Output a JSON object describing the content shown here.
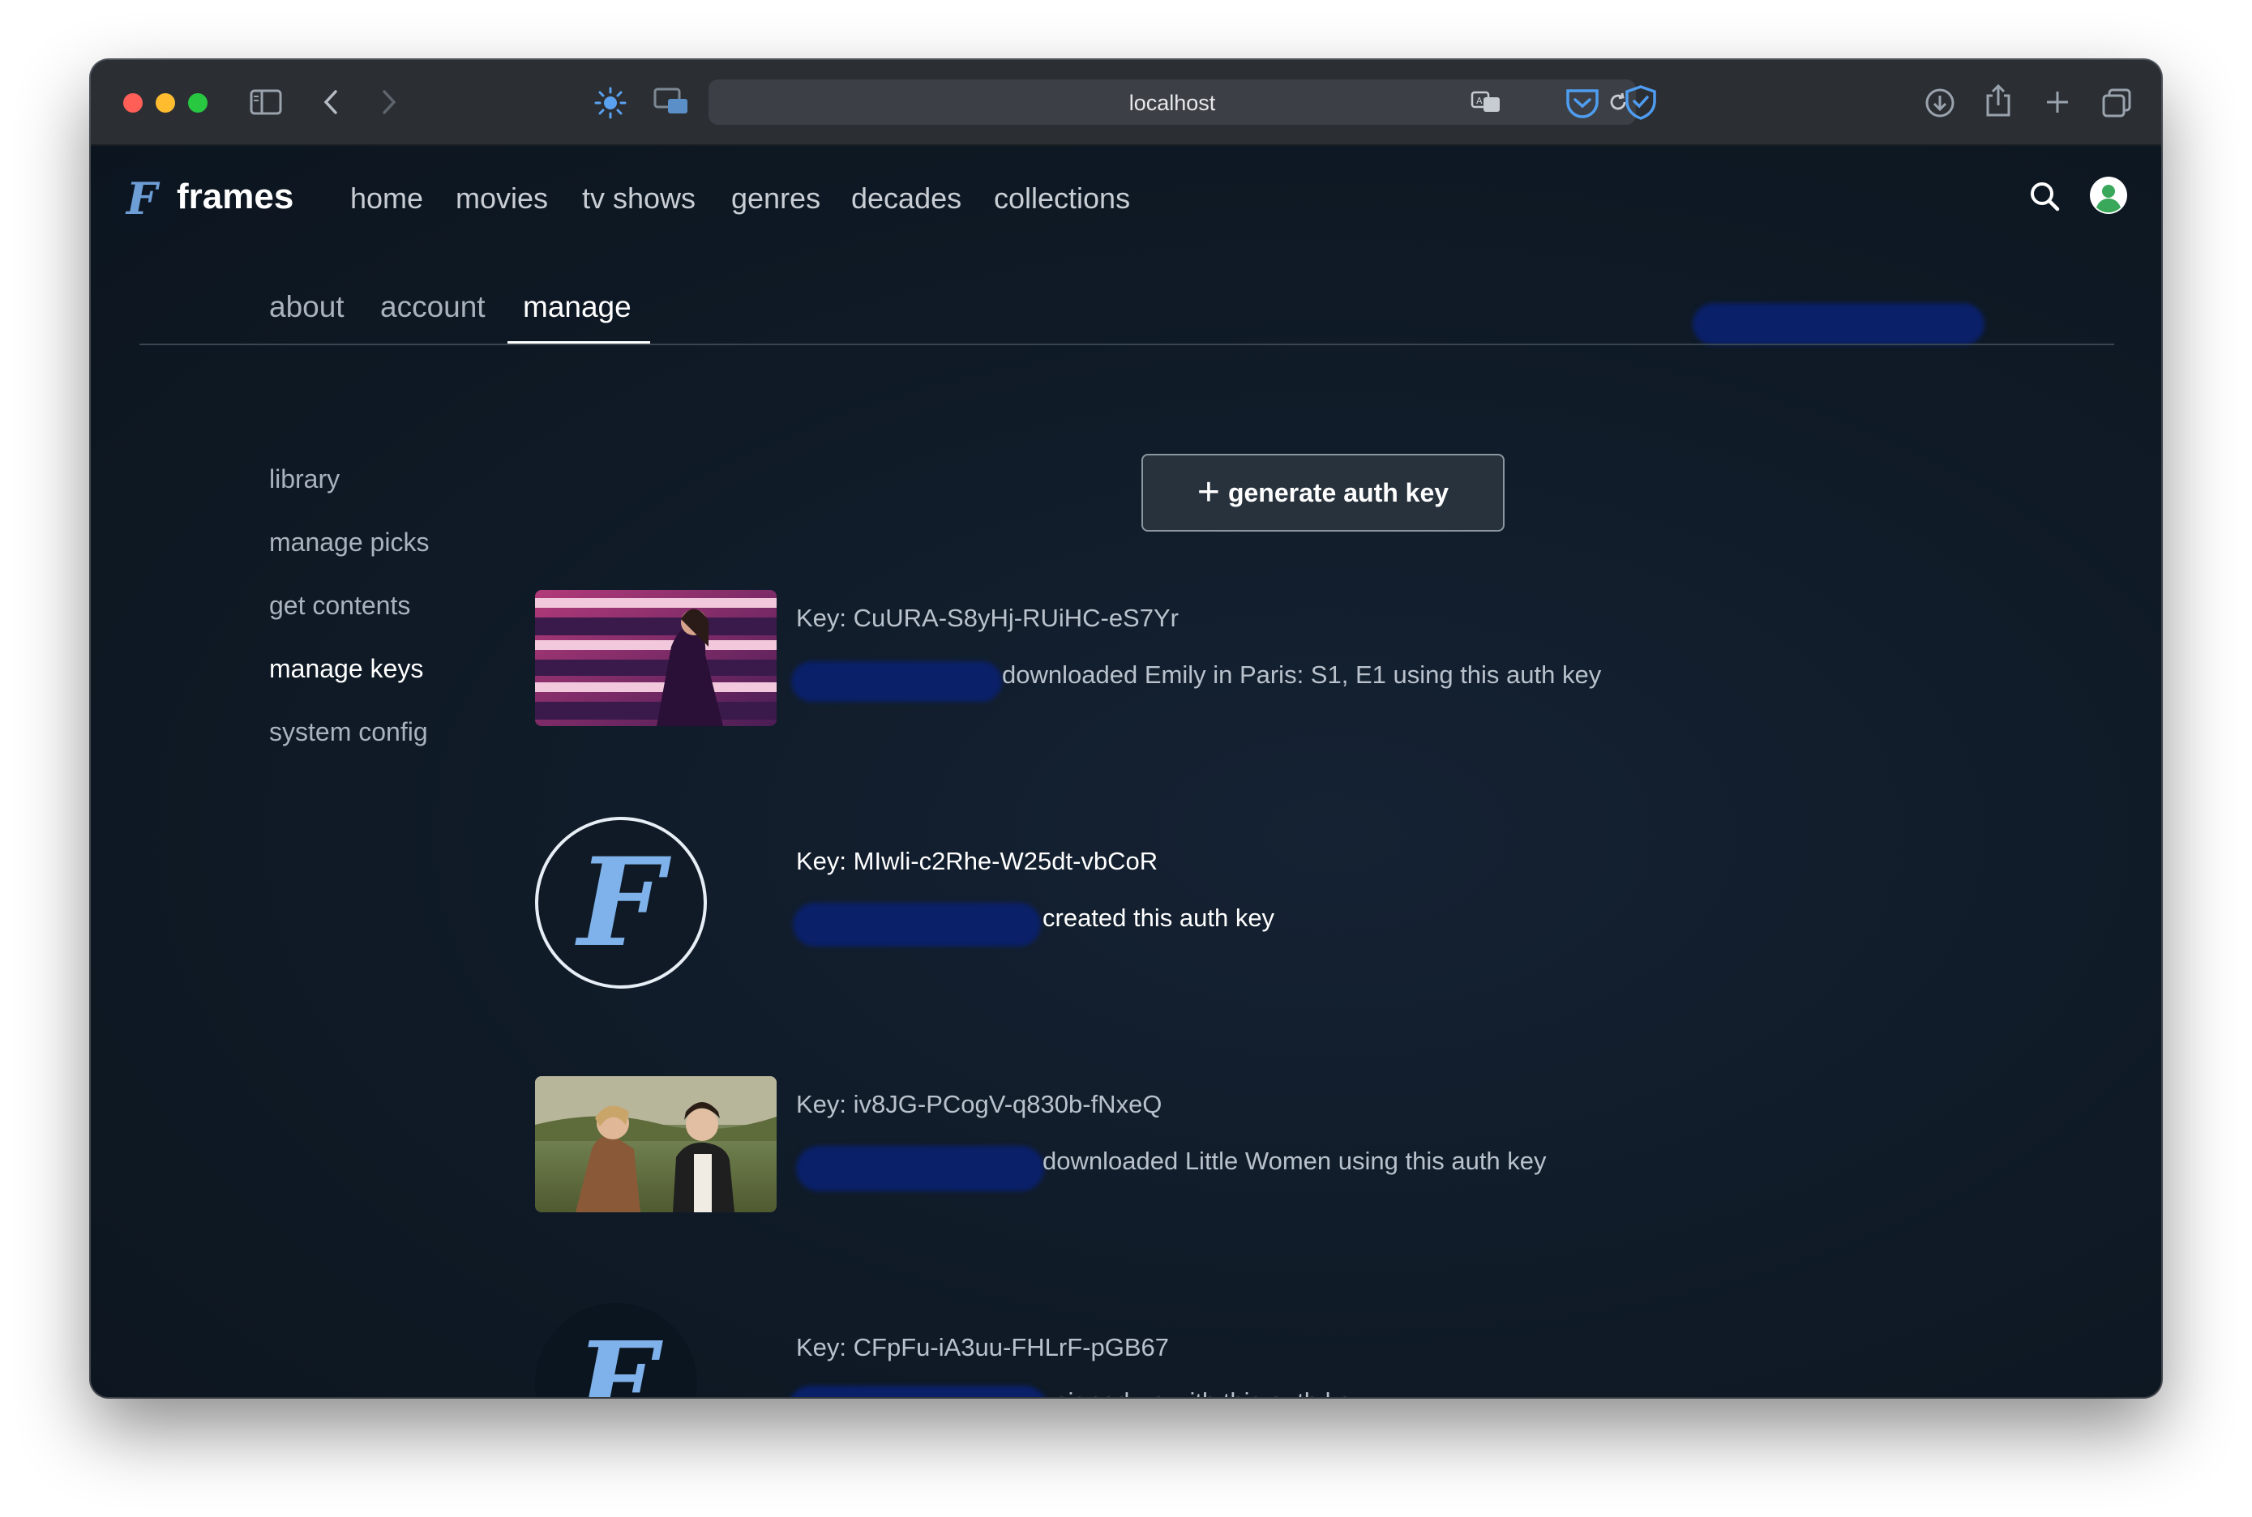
{
  "browser": {
    "url": "localhost"
  },
  "app": {
    "brand_letter": "F",
    "brand_name": "frames",
    "nav": [
      "home",
      "movies",
      "tv shows",
      "genres",
      "decades",
      "collections"
    ]
  },
  "tabs": [
    "about",
    "account",
    "manage"
  ],
  "active_tab": "manage",
  "sidebar": {
    "items": [
      "library",
      "manage picks",
      "get contents",
      "manage keys",
      "system config"
    ],
    "active": "manage keys"
  },
  "actions": {
    "generate_label": "generate auth key"
  },
  "keys": [
    {
      "key": "Key: CuURA-S8yHj-RUiHC-eS7Yr",
      "description": "downloaded Emily in Paris: S1, E1 using this auth key",
      "thumbnail": "emily-in-paris-still"
    },
    {
      "key": "Key: MIwli-c2Rhe-W25dt-vbCoR",
      "description": "created this auth key",
      "thumbnail": "frames-logo"
    },
    {
      "key": "Key: iv8JG-PCogV-q830b-fNxeQ",
      "description": "downloaded Little Women using this auth key",
      "thumbnail": "little-women-still"
    },
    {
      "key": "Key: CFpFu-iA3uu-FHLrF-pGB67",
      "description": "signed up with this auth key",
      "thumbnail": "frames-logo"
    }
  ],
  "colors": {
    "page_bg": "#0f1923",
    "accent_logo": "#7fb2ea",
    "redaction": "#0a2069"
  }
}
